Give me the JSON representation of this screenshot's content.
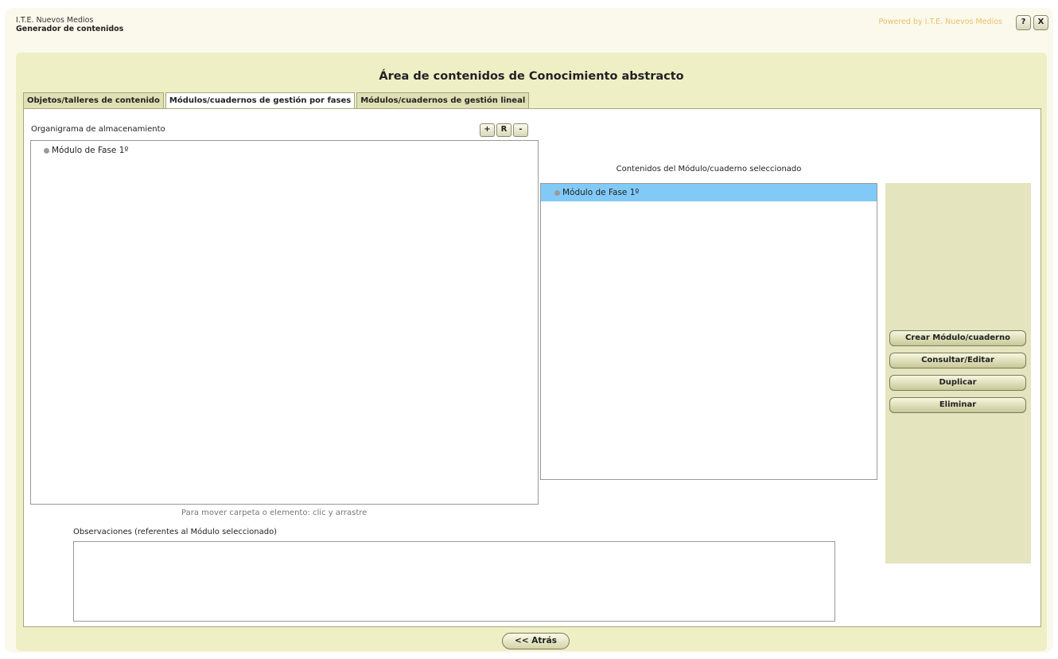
{
  "header": {
    "company": "I.T.E. Nuevos Medios",
    "app_name": "Generador de contenidos",
    "powered_by": "Powered by I.T.E. Nuevos Medios",
    "help_label": "?",
    "close_label": "X"
  },
  "main": {
    "title": "Área de contenidos de Conocimiento abstracto",
    "tabs": [
      {
        "label": "Objetos/talleres de contenido"
      },
      {
        "label": "Módulos/cuadernos de gestión por fases",
        "active": true
      },
      {
        "label": "Módulos/cuadernos de gestión lineal"
      }
    ]
  },
  "organigram": {
    "label": "Organigrama de almacenamiento",
    "buttons": {
      "add": "+",
      "reset": "R",
      "remove": "-"
    },
    "nodes": [
      {
        "label": "Módulo de Fase 1º"
      }
    ],
    "drag_hint": "Para mover carpeta o elemento: clic y arrastre"
  },
  "contents": {
    "label": "Contenidos del Módulo/cuaderno seleccionado",
    "items": [
      {
        "label": "Módulo de Fase 1º",
        "selected": true
      }
    ]
  },
  "actions": {
    "create": "Crear Módulo/cuaderno",
    "edit": "Consultar/Editar",
    "duplicate": "Duplicar",
    "delete": "Eliminar"
  },
  "observations": {
    "label": "Observaciones (referentes al Módulo seleccionado)",
    "value": ""
  },
  "footer": {
    "back_label": "<< Atrás"
  },
  "colors": {
    "panel_bg": "#efefc6",
    "selected_row": "#81caf7",
    "powered_text": "#e8c06a"
  }
}
